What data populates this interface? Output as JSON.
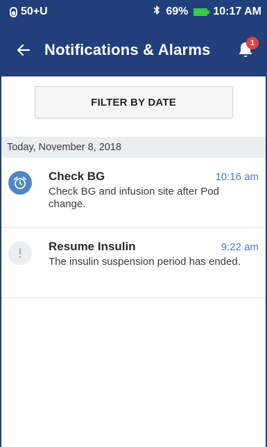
{
  "status_bar": {
    "pod_label": "50+U",
    "battery_percent": "69%",
    "time": "10:17 AM",
    "colors": {
      "bar": "#213f7a",
      "battery": "#3cc84a"
    }
  },
  "header": {
    "title": "Notifications & Alarms",
    "badge_count": "1",
    "icons": {
      "back": "back-arrow-icon",
      "bell": "bell-icon",
      "bluetooth": "bluetooth-icon"
    }
  },
  "filter": {
    "label": "FILTER BY DATE"
  },
  "section": {
    "date_label": "Today, November 8, 2018"
  },
  "notifications": [
    {
      "title": "Check BG",
      "time": "10:16 am",
      "text": "Check BG and infusion site after Pod change.",
      "icon": "alarm-clock-icon",
      "icon_color": "#4f86c6"
    },
    {
      "title": "Resume Insulin",
      "time": "9:22 am",
      "text": "The insulin suspension period has ended.",
      "icon": "exclamation-icon",
      "icon_color": "#e9eef3"
    }
  ],
  "accent": {
    "time_color": "#3f7fc1",
    "badge_color": "#e8413a"
  }
}
